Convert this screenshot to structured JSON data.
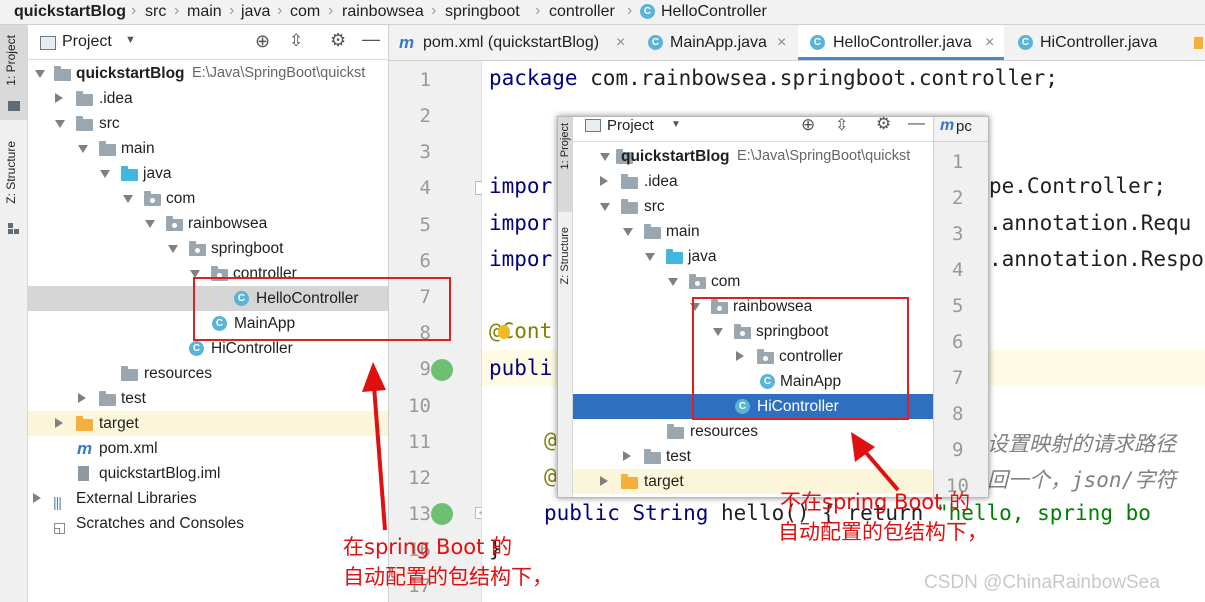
{
  "breadcrumb": {
    "items": [
      "quickstartBlog",
      "src",
      "main",
      "java",
      "com",
      "rainbowsea",
      "springboot",
      "controller",
      "HelloController"
    ]
  },
  "left_stripe": {
    "project_tab": "1: Project",
    "structure_tab": "Z: Structure"
  },
  "project_panel": {
    "title": "Project",
    "tree": [
      {
        "label": "quickstartBlog",
        "path": "E:\\Java\\SpringBoot\\quickst",
        "icon": "module-folder-icon"
      },
      {
        "label": ".idea",
        "icon": "folder-icon"
      },
      {
        "label": "src",
        "icon": "folder-icon"
      },
      {
        "label": "main",
        "icon": "folder-icon"
      },
      {
        "label": "java",
        "icon": "source-folder-icon"
      },
      {
        "label": "com",
        "icon": "package-icon"
      },
      {
        "label": "rainbowsea",
        "icon": "package-icon"
      },
      {
        "label": "springboot",
        "icon": "package-icon"
      },
      {
        "label": "controller",
        "icon": "package-icon"
      },
      {
        "label": "HelloController",
        "icon": "class-icon"
      },
      {
        "label": "MainApp",
        "icon": "spring-class-icon"
      },
      {
        "label": "HiController",
        "icon": "class-icon"
      },
      {
        "label": "resources",
        "icon": "resources-folder-icon"
      },
      {
        "label": "test",
        "icon": "folder-icon"
      },
      {
        "label": "target",
        "icon": "excluded-folder-icon"
      },
      {
        "label": "pom.xml",
        "icon": "maven-icon"
      },
      {
        "label": "quickstartBlog.iml",
        "icon": "iml-file-icon"
      },
      {
        "label": "External Libraries",
        "icon": "library-icon"
      },
      {
        "label": "Scratches and Consoles",
        "icon": "scratches-icon"
      }
    ]
  },
  "tabs": [
    {
      "label": "pom.xml (quickstartBlog)",
      "icon": "maven-icon"
    },
    {
      "label": "MainApp.java",
      "icon": "spring-class-icon"
    },
    {
      "label": "HelloController.java",
      "icon": "class-icon",
      "active": true
    },
    {
      "label": "HiController.java",
      "icon": "class-icon"
    }
  ],
  "gutter": {
    "line_numbers": [
      "1",
      "2",
      "3",
      "4",
      "5",
      "6",
      "7",
      "8",
      "9",
      "10",
      "11",
      "12",
      "13",
      "16",
      "17"
    ]
  },
  "code": {
    "line1": "package com.rainbowsea.springboot.controller;",
    "line4_a": "impor",
    "line4_b": "pe.Controller;",
    "line5_a": "impor",
    "line5_b": ".annotation.Requ",
    "line6_a": "impor",
    "line6_b": ".annotation.Respo",
    "line8": "@Cont",
    "line9": "publi",
    "line11_a": "@",
    "line11_b": "设置映射的请求路径",
    "line12_a": "@",
    "line12_b": "回一个，json/字符",
    "line13_a": "public String ",
    "line13_b": "hello() { return ",
    "line13_c": "\"hello, spring bo",
    "line16": "}"
  },
  "overlay": {
    "title": "Project",
    "tab_fragment": "pc",
    "stripe_project": "1: Project",
    "stripe_structure": "Z: Structure",
    "tree": [
      {
        "label": "quickstartBlog",
        "path": "E:\\Java\\SpringBoot\\quickst"
      },
      {
        "label": ".idea"
      },
      {
        "label": "src"
      },
      {
        "label": "main"
      },
      {
        "label": "java"
      },
      {
        "label": "com"
      },
      {
        "label": "rainbowsea"
      },
      {
        "label": "springboot"
      },
      {
        "label": "controller"
      },
      {
        "label": "MainApp"
      },
      {
        "label": "HiController",
        "selected": true
      },
      {
        "label": "resources"
      },
      {
        "label": "test"
      },
      {
        "label": "target"
      }
    ],
    "line_numbers": [
      "1",
      "2",
      "3",
      "4",
      "5",
      "6",
      "7",
      "8",
      "9",
      "10"
    ]
  },
  "annotations": {
    "left_line1": "在spring Boot 的",
    "left_line2": "自动配置的包结构下，",
    "right_line1": "不在spring Boot 的",
    "right_line2": "自动配置的包结构下，"
  },
  "watermark": "CSDN @ChinaRainbowSea",
  "colors": {
    "accent": "#4a88c7",
    "selection": "#2f6fbf",
    "annotation_red": "#e01010",
    "keyword": "#000080",
    "annotation": "#808000",
    "string": "#008000"
  }
}
